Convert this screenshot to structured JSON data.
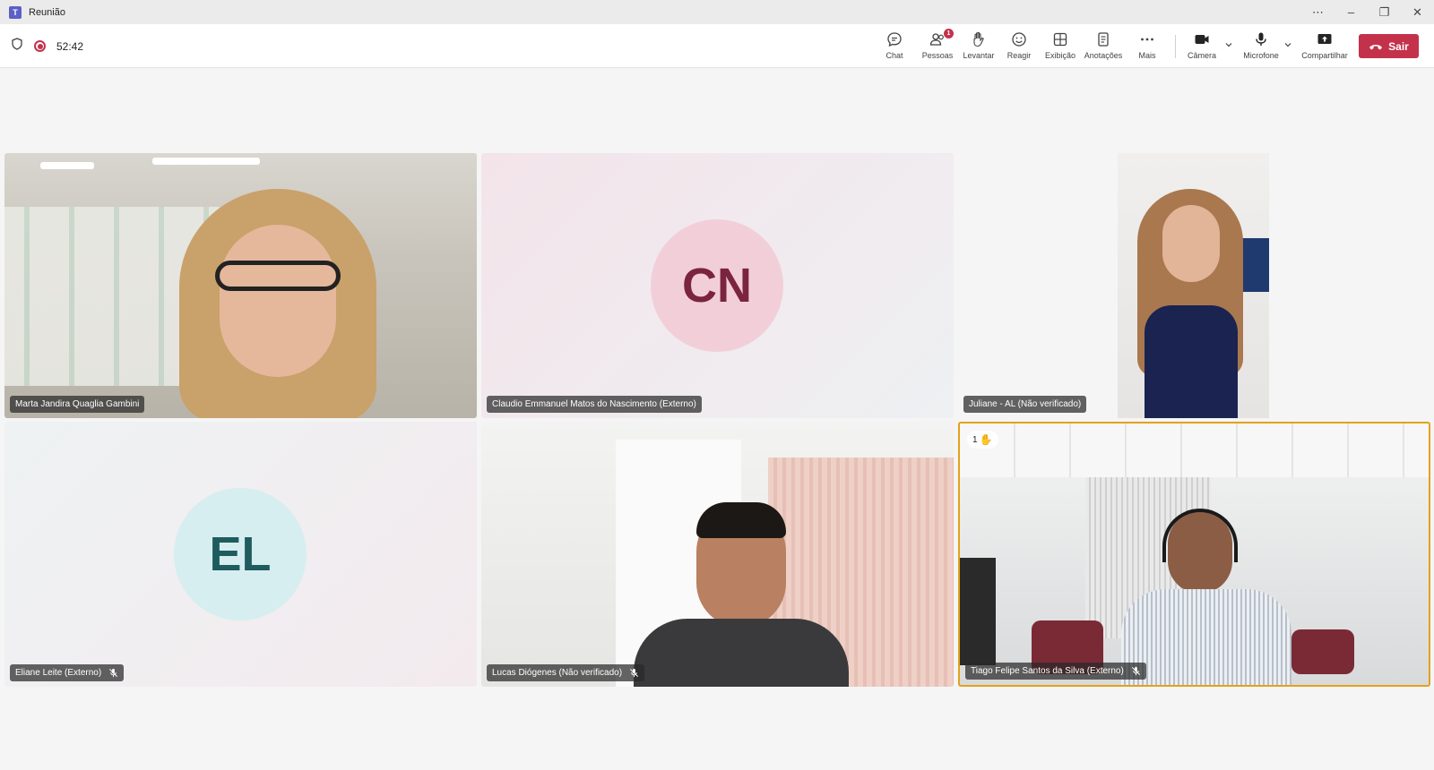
{
  "window": {
    "title": "Reunião",
    "app_icon_letter": "T"
  },
  "toolbar": {
    "timer": "52:42",
    "chat": "Chat",
    "people": "Pessoas",
    "people_badge": "1",
    "raise": "Levantar",
    "react": "Reagir",
    "view": "Exibição",
    "notes": "Anotações",
    "more": "Mais",
    "camera": "Câmera",
    "mic": "Microfone",
    "share": "Compartilhar",
    "leave": "Sair"
  },
  "participants": [
    {
      "name": "Marta Jandira Quaglia Gambini"
    },
    {
      "name": "Claudio Emmanuel Matos do Nascimento (Externo)",
      "initials": "CN"
    },
    {
      "name": "Juliane - AL (Não verificado)"
    },
    {
      "name": "Eliane Leite (Externo)",
      "initials": "EL"
    },
    {
      "name": "Lucas Diógenes (Não verificado)"
    },
    {
      "name": "Tiago Felipe Santos da Silva (Externo)",
      "hand_count": "1"
    }
  ],
  "colors": {
    "accent": "#5b5fc7",
    "leave": "#c4314b",
    "active_speaker": "#e3a21a",
    "cn_avatar_bg": "#f2cfd8",
    "cn_avatar_fg": "#7a2440",
    "el_avatar_bg": "#d6eef0",
    "el_avatar_fg": "#1f5c5e"
  }
}
